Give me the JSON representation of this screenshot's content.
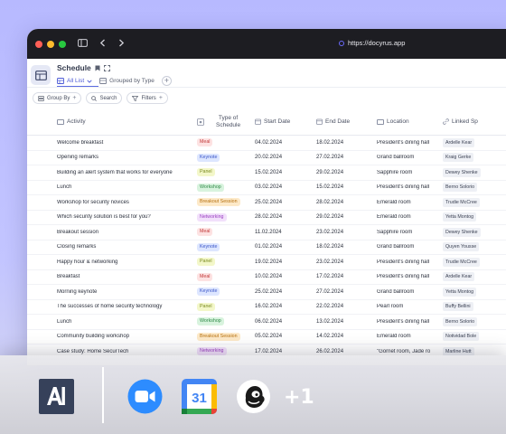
{
  "browser": {
    "url": "https://docyrus.app"
  },
  "header": {
    "title": "Schedule",
    "views": [
      {
        "label": "All List",
        "active": true
      },
      {
        "label": "Grouped by Type",
        "active": false
      }
    ],
    "toolbar": {
      "group_by": "Group By",
      "search": "Search",
      "filters": "Filters"
    }
  },
  "columns": {
    "activity": "Activity",
    "type_line1": "Type of",
    "type_line2": "Schedule",
    "start": "Start Date",
    "end": "End Date",
    "location": "Location",
    "linked": "Linked Sp"
  },
  "tag_colors": {
    "Meal": {
      "bg": "#fde2e2",
      "fg": "#c23a3a"
    },
    "Keynote": {
      "bg": "#dde6ff",
      "fg": "#3a55c8"
    },
    "Panel": {
      "bg": "#f3f7c9",
      "fg": "#7a8a1f"
    },
    "Workshop": {
      "bg": "#d8f3de",
      "fg": "#2f8a47"
    },
    "Breakout Session": {
      "bg": "#fde9c8",
      "fg": "#b6700f"
    },
    "Networking": {
      "bg": "#f2e0fb",
      "fg": "#9a3ec0"
    }
  },
  "rows": [
    {
      "activity": "Welcome breakfast",
      "type": "Meal",
      "start": "04.02.2024",
      "end": "18.02.2024",
      "location": "President's dining hall",
      "linked": "Ardelle Kear"
    },
    {
      "activity": "Opening remarks",
      "type": "Keynote",
      "start": "20.02.2024",
      "end": "27.02.2024",
      "location": "Grand ballroom",
      "linked": "Kraig Gerke"
    },
    {
      "activity": "Building an alert system that works for everyone",
      "type": "Panel",
      "start": "15.02.2024",
      "end": "29.02.2024",
      "location": "Sapphire room",
      "linked": "Dewey Shenke"
    },
    {
      "activity": "Lunch",
      "type": "Workshop",
      "start": "03.02.2024",
      "end": "15.02.2024",
      "location": "President's dining hall",
      "linked": "Berno Solorio"
    },
    {
      "activity": "Workshop for security novices",
      "type": "Breakout Session",
      "start": "25.02.2024",
      "end": "28.02.2024",
      "location": "Emerald room",
      "linked": "Trudie McCree"
    },
    {
      "activity": "Which security solution is best for you?",
      "type": "Networking",
      "start": "28.02.2024",
      "end": "29.02.2024",
      "location": "Emerald room",
      "linked": "Yetta Montog"
    },
    {
      "activity": "Breakout session",
      "type": "Meal",
      "start": "11.02.2024",
      "end": "23.02.2024",
      "location": "Sapphire room",
      "linked": "Dewey Shenke"
    },
    {
      "activity": "Closing remarks",
      "type": "Keynote",
      "start": "01.02.2024",
      "end": "18.02.2024",
      "location": "Grand ballroom",
      "linked": "Quyen Yousse"
    },
    {
      "activity": "Happy hour & networking",
      "type": "Panel",
      "start": "19.02.2024",
      "end": "23.02.2024",
      "location": "President's dining hall",
      "linked": "Trudie McCree"
    },
    {
      "activity": "Breakfast",
      "type": "Meal",
      "start": "10.02.2024",
      "end": "17.02.2024",
      "location": "President's dining hall",
      "linked": "Ardelle Kear"
    },
    {
      "activity": "Morning keynote",
      "type": "Keynote",
      "start": "25.02.2024",
      "end": "27.02.2024",
      "location": "Grand ballroom",
      "linked": "Yetta Montog"
    },
    {
      "activity": "The successes of home security technology",
      "type": "Panel",
      "start": "16.02.2024",
      "end": "22.02.2024",
      "location": "Pearl room",
      "linked": "Buffy Bellini"
    },
    {
      "activity": "Lunch",
      "type": "Workshop",
      "start": "06.02.2024",
      "end": "13.02.2024",
      "location": "President's dining hall",
      "linked": "Berno Solorio"
    },
    {
      "activity": "Community building workshop",
      "type": "Breakout Session",
      "start": "05.02.2024",
      "end": "14.02.2024",
      "location": "Emerald room",
      "linked": "Notividad Bole"
    },
    {
      "activity": "Case study: Home SecurTech",
      "type": "Networking",
      "start": "17.02.2024",
      "end": "26.02.2024",
      "location": "\"Gornet room, Jade ro",
      "linked": "Marline Hutt"
    }
  ],
  "dock": {
    "more_label": "+1",
    "calendar_day": "31",
    "apps": [
      "anthropic-logo",
      "zoom-icon",
      "google-calendar-icon",
      "mailchimp-icon"
    ]
  }
}
